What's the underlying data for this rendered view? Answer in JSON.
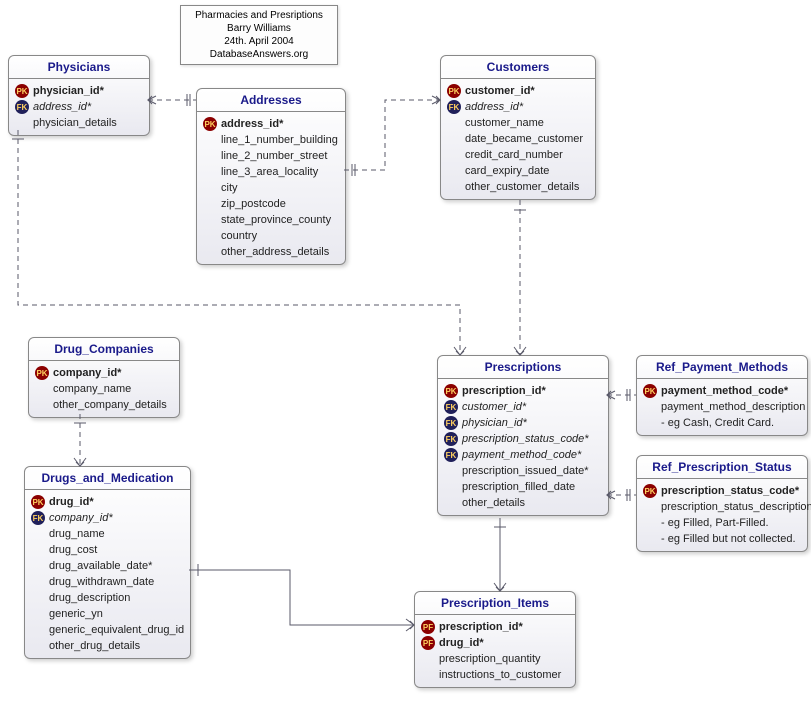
{
  "note": {
    "line1": "Pharmacies and Presriptions",
    "line2": "Barry Williams",
    "line3": "24th. April 2004",
    "line4": "DatabaseAnswers.org"
  },
  "entities": {
    "physicians": {
      "title": "Physicians",
      "attrs": [
        {
          "key": "PK",
          "name": "physician_id*",
          "bold": true
        },
        {
          "key": "FK",
          "name": "address_id*",
          "italic": true
        },
        {
          "key": "",
          "name": "physician_details"
        }
      ]
    },
    "addresses": {
      "title": "Addresses",
      "attrs": [
        {
          "key": "PK",
          "name": "address_id*",
          "bold": true
        },
        {
          "key": "",
          "name": "line_1_number_building"
        },
        {
          "key": "",
          "name": "line_2_number_street"
        },
        {
          "key": "",
          "name": "line_3_area_locality"
        },
        {
          "key": "",
          "name": "city"
        },
        {
          "key": "",
          "name": "zip_postcode"
        },
        {
          "key": "",
          "name": "state_province_county"
        },
        {
          "key": "",
          "name": "country"
        },
        {
          "key": "",
          "name": "other_address_details"
        }
      ]
    },
    "customers": {
      "title": "Customers",
      "attrs": [
        {
          "key": "PK",
          "name": "customer_id*",
          "bold": true
        },
        {
          "key": "FK",
          "name": "address_id*",
          "italic": true
        },
        {
          "key": "",
          "name": "customer_name"
        },
        {
          "key": "",
          "name": "date_became_customer"
        },
        {
          "key": "",
          "name": "credit_card_number"
        },
        {
          "key": "",
          "name": "card_expiry_date"
        },
        {
          "key": "",
          "name": "other_customer_details"
        }
      ]
    },
    "drug_companies": {
      "title": "Drug_Companies",
      "attrs": [
        {
          "key": "PK",
          "name": "company_id*",
          "bold": true
        },
        {
          "key": "",
          "name": "company_name"
        },
        {
          "key": "",
          "name": "other_company_details"
        }
      ]
    },
    "prescriptions": {
      "title": "Prescriptions",
      "attrs": [
        {
          "key": "PK",
          "name": "prescription_id*",
          "bold": true
        },
        {
          "key": "FK",
          "name": "customer_id*",
          "italic": true
        },
        {
          "key": "FK",
          "name": "physician_id*",
          "italic": true
        },
        {
          "key": "FK",
          "name": "prescription_status_code*",
          "italic": true
        },
        {
          "key": "FK",
          "name": "payment_method_code*",
          "italic": true
        },
        {
          "key": "",
          "name": "prescription_issued_date*"
        },
        {
          "key": "",
          "name": "prescription_filled_date"
        },
        {
          "key": "",
          "name": "other_details"
        }
      ]
    },
    "ref_payment_methods": {
      "title": "Ref_Payment_Methods",
      "attrs": [
        {
          "key": "PK",
          "name": "payment_method_code*",
          "bold": true
        },
        {
          "key": "",
          "name": "payment_method_description"
        },
        {
          "key": "",
          "name": "- eg Cash, Credit Card."
        }
      ]
    },
    "ref_prescription_status": {
      "title": "Ref_Prescription_Status",
      "attrs": [
        {
          "key": "PK",
          "name": "prescription_status_code*",
          "bold": true
        },
        {
          "key": "",
          "name": "prescription_status_description"
        },
        {
          "key": "",
          "name": "- eg Filled, Part-Filled."
        },
        {
          "key": "",
          "name": "- eg Filled but not collected."
        }
      ]
    },
    "drugs_and_medication": {
      "title": "Drugs_and_Medication",
      "attrs": [
        {
          "key": "PK",
          "name": "drug_id*",
          "bold": true
        },
        {
          "key": "FK",
          "name": "company_id*",
          "italic": true
        },
        {
          "key": "",
          "name": "drug_name"
        },
        {
          "key": "",
          "name": "drug_cost"
        },
        {
          "key": "",
          "name": "drug_available_date*"
        },
        {
          "key": "",
          "name": "drug_withdrawn_date"
        },
        {
          "key": "",
          "name": "drug_description"
        },
        {
          "key": "",
          "name": "generic_yn"
        },
        {
          "key": "",
          "name": "generic_equivalent_drug_id"
        },
        {
          "key": "",
          "name": "other_drug_details"
        }
      ]
    },
    "prescription_items": {
      "title": "Prescription_Items",
      "attrs": [
        {
          "key": "PF",
          "name": "prescription_id*",
          "bold": true
        },
        {
          "key": "PF",
          "name": "drug_id*",
          "bold": true
        },
        {
          "key": "",
          "name": "prescription_quantity"
        },
        {
          "key": "",
          "name": "instructions_to_customer"
        }
      ]
    }
  }
}
